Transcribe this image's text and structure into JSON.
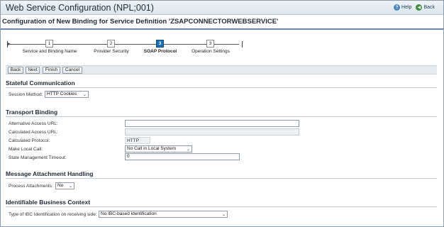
{
  "window": {
    "title": "Web Service Configuration (NPL;001)",
    "help_label": "Help",
    "back_label": "Back"
  },
  "page_title": "Configuration of New Binding for Service Definition 'ZSAPCONNECTORWEBSERVICE'",
  "roadmap": {
    "steps": [
      {
        "number": "1",
        "label": "Service and Binding Name",
        "active": false
      },
      {
        "number": "2",
        "label": "Provider Security",
        "active": false
      },
      {
        "number": "3",
        "label": "SOAP Protocol",
        "active": true
      },
      {
        "number": "3",
        "label": "Operation Settings",
        "active": false
      }
    ]
  },
  "toolbar": {
    "back_label": "Back",
    "next_label": "Next",
    "finish_label": "Finish",
    "cancel_label": "Cancel"
  },
  "stateful": {
    "heading": "Stateful Communication",
    "session_method_label": "Session Method:",
    "session_method_value": "HTTP Cookies"
  },
  "transport": {
    "heading": "Transport Binding",
    "alt_url_label": "Alternative Access URL:",
    "alt_url_value": "",
    "calc_url_label": "Calculated Access URL:",
    "calc_url_value": "",
    "calc_protocol_label": "Calculated Protocol:",
    "calc_protocol_value": "HTTP",
    "local_call_label": "Make Local Call:",
    "local_call_value": "No Call in Local System",
    "timeout_label": "State Management Timeout:",
    "timeout_value": "0"
  },
  "attachments": {
    "heading": "Message Attachment Handling",
    "process_label": "Process Attachments:",
    "process_value": "No"
  },
  "business_context": {
    "heading": "Identifiable Business Context",
    "ibc_label": "Type of IBC Identification on receiving side:",
    "ibc_value": "No IBC-based identification"
  }
}
